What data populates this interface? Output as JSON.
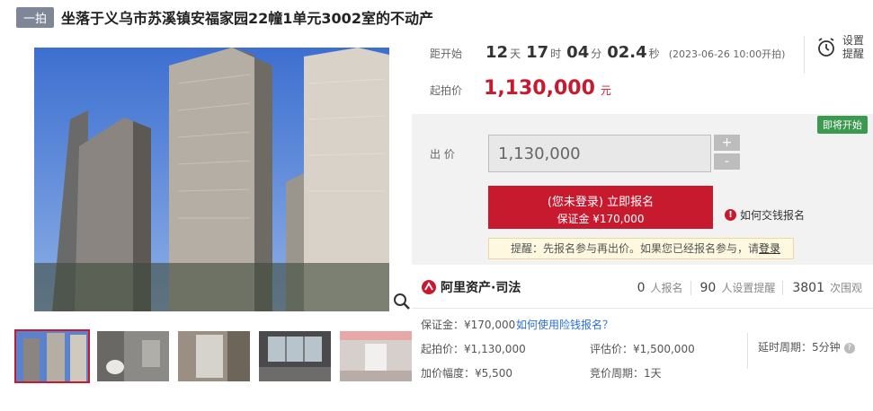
{
  "header": {
    "badge": "一拍",
    "title": "坐落于义乌市苏溪镇安福家园22幢1单元3002室的不动产"
  },
  "countdown": {
    "label": "距开始",
    "days": "12",
    "days_unit": "天",
    "hours": "17",
    "hours_unit": "时",
    "minutes": "04",
    "minutes_unit": "分",
    "seconds": "02.4",
    "seconds_unit": "秒",
    "start_note": "(2023-06-26 10:00开拍)"
  },
  "remind": {
    "line1": "设置",
    "line2": "提醒"
  },
  "start_price": {
    "label": "起拍价",
    "value": "1,130,000",
    "unit": "元"
  },
  "bid": {
    "status": "即将开始",
    "label": "出 价",
    "input_value": "1,130,000",
    "plus": "+",
    "minus": "-",
    "register_line1": "(您未登录) 立即报名",
    "register_line2": "保证金 ¥170,000",
    "how_pay": "如何交钱报名",
    "tip_text": "提醒：先报名参与再出价。如果您已经报名参与，请",
    "tip_link": "登录"
  },
  "stats": {
    "brand": "阿里资产·司法",
    "items": [
      {
        "num": "0",
        "unit": "人报名"
      },
      {
        "num": "90",
        "unit": "人设置提醒"
      },
      {
        "num": "3801",
        "unit": "次围观"
      }
    ]
  },
  "details": {
    "deposit": "保证金：¥170,000",
    "deposit_link": "如何使用险钱报名？",
    "start_price": "起拍价：¥1,130,000",
    "appraisal": "评估价：¥1,500,000",
    "delay": "延时周期：5分钟",
    "increment": "加价幅度：¥5,500",
    "bid_period": "竞价周期：1天"
  },
  "colors": {
    "accent": "#c71a2f",
    "status_green": "#3b9a4e",
    "badge_gray": "#7e8798",
    "sky": "#4e78c8"
  },
  "icons": [
    "alarm-clock-icon",
    "zoom-icon",
    "info-icon",
    "help-icon",
    "brand-logo-icon"
  ]
}
